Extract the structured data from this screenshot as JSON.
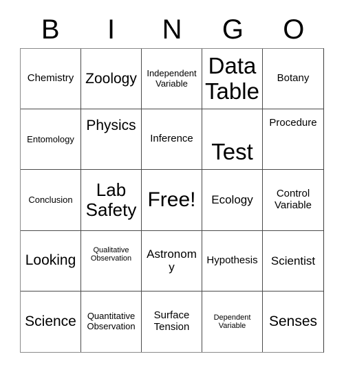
{
  "card": {
    "title_letters": [
      "B",
      "I",
      "N",
      "G",
      "O"
    ],
    "free_space_label": "Free!",
    "rows": [
      [
        {
          "label": "Chemistry",
          "size": "t-md",
          "align": "v-center"
        },
        {
          "label": "Zoology",
          "size": "t-xl",
          "align": "v-center"
        },
        {
          "label": "Independent Variable",
          "size": "t-sm",
          "align": "v-center"
        },
        {
          "label": "Data Table",
          "size": "t-mega",
          "align": "v-center"
        },
        {
          "label": "Botany",
          "size": "t-md",
          "align": "v-center"
        }
      ],
      [
        {
          "label": "Entomology",
          "size": "t-sm",
          "align": "v-center"
        },
        {
          "label": "Physics",
          "size": "t-xl",
          "align": "v-top"
        },
        {
          "label": "Inference",
          "size": "t-md",
          "align": "v-center"
        },
        {
          "label": "Test",
          "size": "t-mega",
          "align": "v-bottom"
        },
        {
          "label": "Procedure",
          "size": "t-md",
          "align": "v-top"
        }
      ],
      [
        {
          "label": "Conclusion",
          "size": "t-sm",
          "align": "v-center"
        },
        {
          "label": "Lab Safety",
          "size": "t-xxl",
          "align": "v-center"
        },
        {
          "label": "Free!",
          "size": "t-huge",
          "align": "v-center"
        },
        {
          "label": "Ecology",
          "size": "t-lg",
          "align": "v-center"
        },
        {
          "label": "Control Variable",
          "size": "t-md",
          "align": "v-center"
        }
      ],
      [
        {
          "label": "Looking",
          "size": "t-xl",
          "align": "v-center"
        },
        {
          "label": "Qualitative Observation",
          "size": "t-xs",
          "align": "v-upper"
        },
        {
          "label": "Astronomy",
          "size": "t-lg",
          "align": "v-center"
        },
        {
          "label": "Hypothesis",
          "size": "t-md",
          "align": "v-center"
        },
        {
          "label": "Scientist",
          "size": "t-lg",
          "align": "v-center"
        }
      ],
      [
        {
          "label": "Science",
          "size": "t-xl",
          "align": "v-center"
        },
        {
          "label": "Quantitative Observation",
          "size": "t-sm",
          "align": "v-center"
        },
        {
          "label": "Surface Tension",
          "size": "t-md",
          "align": "v-center"
        },
        {
          "label": "Dependent Variable",
          "size": "t-xs",
          "align": "v-center"
        },
        {
          "label": "Senses",
          "size": "t-xl",
          "align": "v-center"
        }
      ]
    ]
  },
  "colors": {
    "background": "#ffffff",
    "text": "#000000",
    "grid_line": "#4a4a4a",
    "outer_border": "#8a8a8a"
  }
}
